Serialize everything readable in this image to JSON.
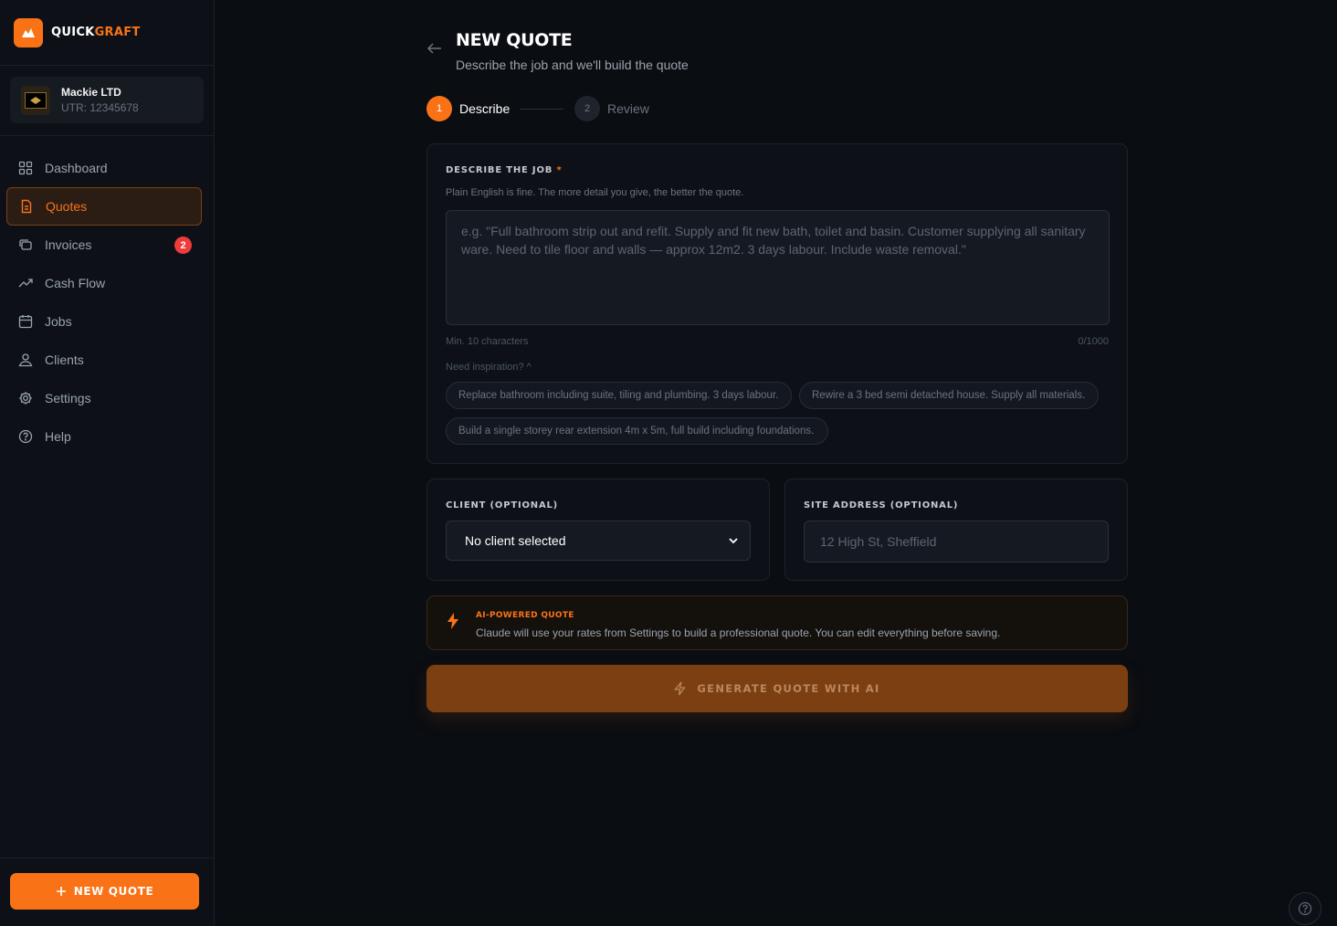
{
  "brand": {
    "word1": "QUICK",
    "word2": "GRAFT",
    "accent": "#f97316"
  },
  "company": {
    "name": "Mackie LTD",
    "utr": "UTR: 12345678"
  },
  "nav": {
    "items": [
      {
        "label": "Dashboard",
        "icon": "grid-icon"
      },
      {
        "label": "Quotes",
        "icon": "document-icon",
        "active": true
      },
      {
        "label": "Invoices",
        "icon": "copy-icon",
        "badge": "2"
      },
      {
        "label": "Cash Flow",
        "icon": "trending-up-icon"
      },
      {
        "label": "Jobs",
        "icon": "calendar-icon"
      },
      {
        "label": "Clients",
        "icon": "users-icon"
      },
      {
        "label": "Settings",
        "icon": "gear-icon"
      },
      {
        "label": "Help",
        "icon": "help-circle-icon"
      }
    ]
  },
  "sidebar_footer": {
    "new_quote_label": "NEW QUOTE"
  },
  "header": {
    "title": "NEW QUOTE",
    "subtitle": "Describe the job and we'll build the quote"
  },
  "stepper": {
    "steps": [
      {
        "number": "1",
        "label": "Describe",
        "state": "active"
      },
      {
        "number": "2",
        "label": "Review",
        "state": "pending"
      }
    ]
  },
  "describe": {
    "label": "DESCRIBE THE JOB",
    "required_mark": "*",
    "hint": "Plain English is fine. The more detail you give, the better the quote.",
    "placeholder": "e.g. \"Full bathroom strip out and refit. Supply and fit new bath, toilet and basin. Customer supplying all sanitary ware. Need to tile floor and walls — approx 12m2. 3 days labour. Include waste removal.\"",
    "value": "",
    "min_chars": "Min. 10 characters",
    "char_count": "0/1000",
    "inspiration_toggle": "Need inspiration? ^",
    "suggestions": [
      "Replace bathroom including suite, tiling and plumbing. 3 days labour.",
      "Rewire a 3 bed semi detached house. Supply all materials.",
      "Build a single storey rear extension 4m x 5m, full build including foundations."
    ]
  },
  "client": {
    "label": "CLIENT (OPTIONAL)",
    "selected": "No client selected"
  },
  "site_address": {
    "label": "SITE ADDRESS (OPTIONAL)",
    "placeholder": "12 High St, Sheffield",
    "value": ""
  },
  "ai_notice": {
    "title": "AI-POWERED QUOTE",
    "description": "Claude will use your rates from Settings to build a professional quote. You can edit everything before saving."
  },
  "generate_button": {
    "label": "GENERATE QUOTE WITH AI",
    "state": "disabled"
  }
}
